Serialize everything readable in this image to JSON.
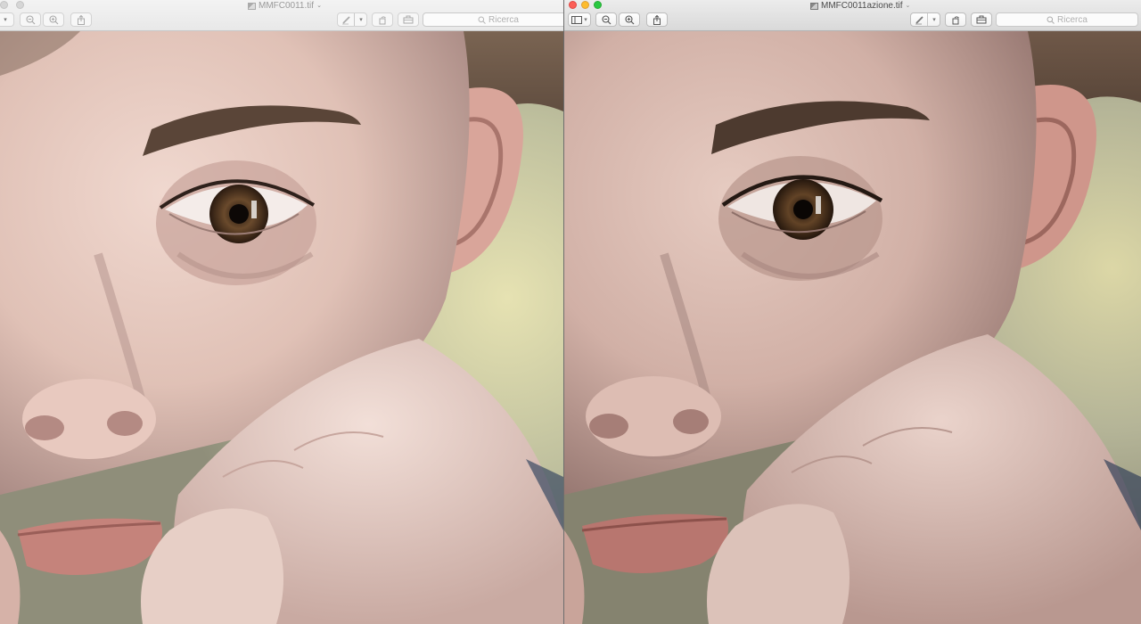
{
  "windows": {
    "left": {
      "title": "MMFC0011.tif",
      "search_placeholder": "Ricerca",
      "active": false
    },
    "right": {
      "title": "MMFC0011azione.tif",
      "search_placeholder": "Ricerca",
      "active": true
    }
  },
  "icons": {
    "sidebar": "sidebar-icon",
    "zoom_out": "zoom-out-icon",
    "zoom_in": "zoom-in-icon",
    "share": "share-icon",
    "markup": "pen-icon",
    "rotate": "rotate-icon",
    "toolbox": "toolbox-icon",
    "search": "magnifier-icon"
  },
  "colors": {
    "traffic_red": "#fc5f57",
    "traffic_yellow": "#fdbc2e",
    "traffic_green": "#28c840",
    "skin_light": "#e9cdc3",
    "skin_shadow": "#b99a93",
    "hair": "#6b5646",
    "background_blur": "#c4c2a3"
  }
}
